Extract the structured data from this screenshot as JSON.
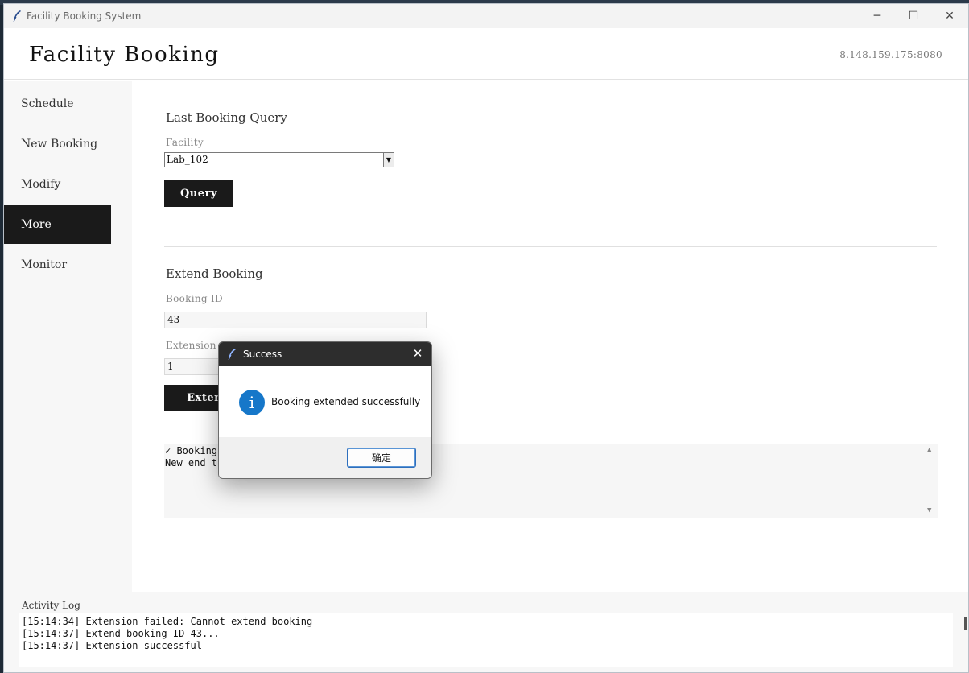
{
  "window": {
    "title": "Facility Booking System",
    "controls": {
      "minimize": "─",
      "maximize": "☐",
      "close": "✕"
    }
  },
  "header": {
    "title": "Facility Booking",
    "server": "8.148.159.175:8080"
  },
  "sidebar": {
    "items": [
      {
        "label": "Schedule",
        "active": false
      },
      {
        "label": "New Booking",
        "active": false
      },
      {
        "label": "Modify",
        "active": false
      },
      {
        "label": "More",
        "active": true
      },
      {
        "label": "Monitor",
        "active": false
      }
    ]
  },
  "last_query": {
    "title": "Last Booking Query",
    "facility_label": "Facility",
    "facility_value": "Lab_102",
    "query_button": "Query"
  },
  "extend": {
    "title": "Extend Booking",
    "booking_id_label": "Booking ID",
    "booking_id_value": "43",
    "extension_label": "Extension (minutes)",
    "extension_value": "1",
    "extend_button": "Extend"
  },
  "result": {
    "lines": [
      "✓ Booking",
      "New end ti"
    ]
  },
  "activity_log": {
    "label": "Activity Log",
    "lines": [
      "[15:14:34] Extension failed: Cannot extend booking",
      "[15:14:37] Extend booking ID 43...",
      "[15:14:37] Extension successful"
    ]
  },
  "dialog": {
    "title": "Success",
    "icon": "info-icon",
    "icon_glyph": "i",
    "message": "Booking extended successfully",
    "ok_button": "确定",
    "close_glyph": "✕"
  },
  "colors": {
    "accent_dark": "#1a1a1a",
    "info_blue": "#1677c9",
    "dialog_titlebar": "#2d2d2d"
  }
}
